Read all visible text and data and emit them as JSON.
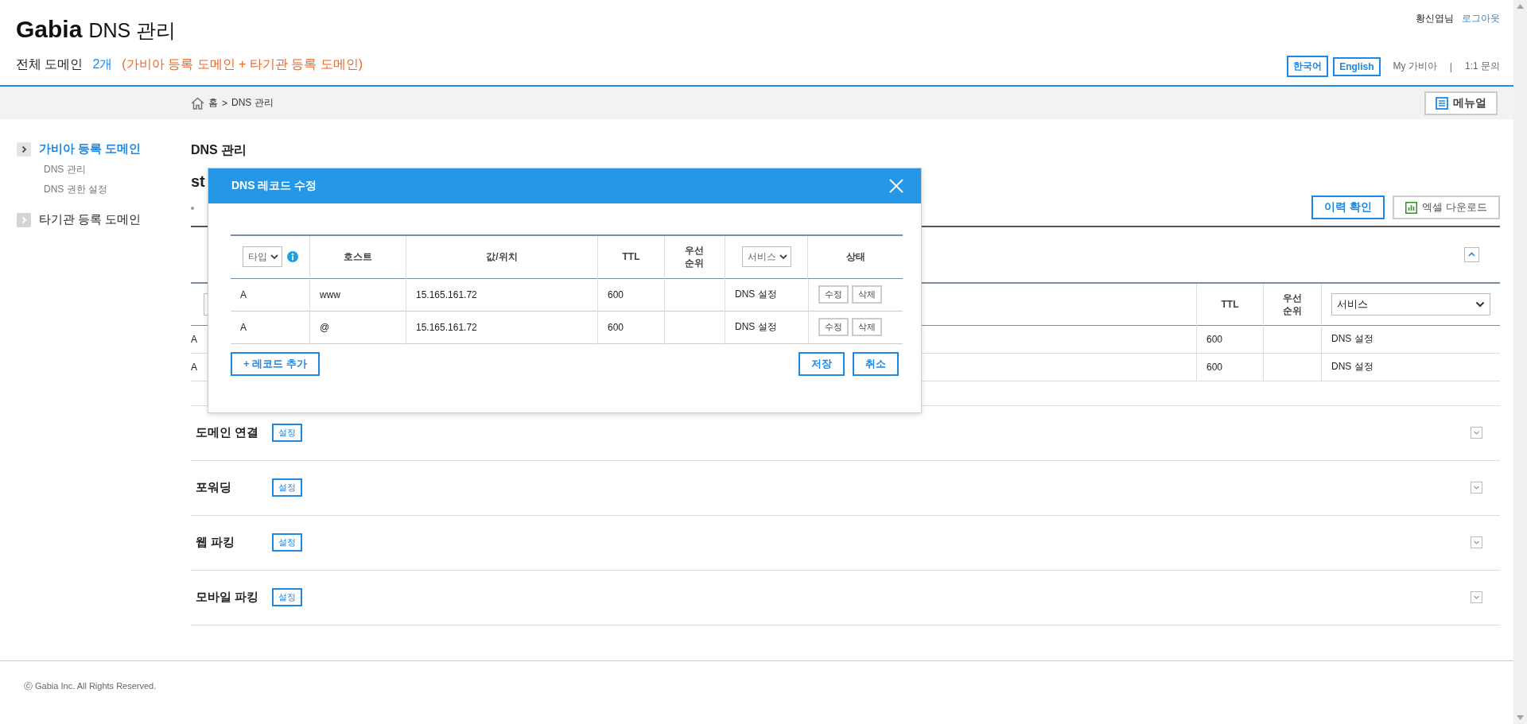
{
  "header": {
    "logo": "Gabia",
    "product": "DNS 관리",
    "summary_label": "전체 도메인",
    "summary_count": "2개",
    "summary_note": "(가비아 등록 도메인 + 타기관 등록 도메인)",
    "user": "황신엽님",
    "logout": "로그아웃",
    "languages": [
      "한국어",
      "English"
    ],
    "links": [
      "My 가비아",
      "1:1 문의"
    ],
    "link_separator": "|"
  },
  "breadcrumb": {
    "home": "홈",
    "separator": ">",
    "current": "DNS 관리"
  },
  "manual_button": "메뉴얼",
  "sidebar": {
    "items": [
      {
        "label": "가비아 등록 도메인",
        "selected": true,
        "children": [
          {
            "label": "DNS 관리"
          },
          {
            "label": "DNS 권한 설정"
          }
        ]
      },
      {
        "label": "타기관 등록 도메인",
        "selected": false
      }
    ]
  },
  "main": {
    "heading": "DNS 관리",
    "domain": "st",
    "actions": [
      {
        "kind": "primary",
        "label": "이력 확인"
      },
      {
        "kind": "excel",
        "label": "엑셀 다운로드"
      }
    ],
    "records": {
      "expanded": true,
      "columns": [
        {
          "kind": "select"
        },
        {
          "kind": "text",
          "label": "TTL"
        },
        {
          "kind": "text",
          "label": "우선 순위"
        },
        {
          "kind": "select",
          "label": "서비스"
        }
      ],
      "rows": [
        {
          "type": "A",
          "ttl": "600",
          "service": "DNS 설정"
        },
        {
          "type": "A",
          "ttl": "600",
          "service": "DNS 설정"
        }
      ]
    },
    "sections": [
      {
        "title": "도메인 연결",
        "button": "설정",
        "expanded": false
      },
      {
        "title": "포워딩",
        "button": "설정",
        "expanded": false
      },
      {
        "title": "웹 파킹",
        "button": "설정",
        "expanded": false
      },
      {
        "title": "모바일 파킹",
        "button": "설정",
        "expanded": false
      }
    ]
  },
  "modal": {
    "title": "DNS 레코드 수정",
    "columns": [
      {
        "kind": "select",
        "label": "타입"
      },
      {
        "kind": "text",
        "label": "호스트"
      },
      {
        "kind": "text",
        "label": "값/위치"
      },
      {
        "kind": "text",
        "label": "TTL"
      },
      {
        "kind": "text",
        "label": "우선 순위"
      },
      {
        "kind": "select",
        "label": "서비스"
      },
      {
        "kind": "text",
        "label": "상태"
      }
    ],
    "rows": [
      {
        "type": "A",
        "host": "www",
        "value": "15.165.161.72",
        "ttl": "600",
        "service": "DNS 설정",
        "actions": [
          "수정",
          "삭제"
        ]
      },
      {
        "type": "A",
        "host": "@",
        "value": "15.165.161.72",
        "ttl": "600",
        "service": "DNS 설정",
        "actions": [
          "수정",
          "삭제"
        ]
      }
    ],
    "add_button": "+ 레코드 추가",
    "save_button": "저장",
    "cancel_button": "취소"
  },
  "footer": "ⓒ Gabia Inc. All Rights Reserved."
}
